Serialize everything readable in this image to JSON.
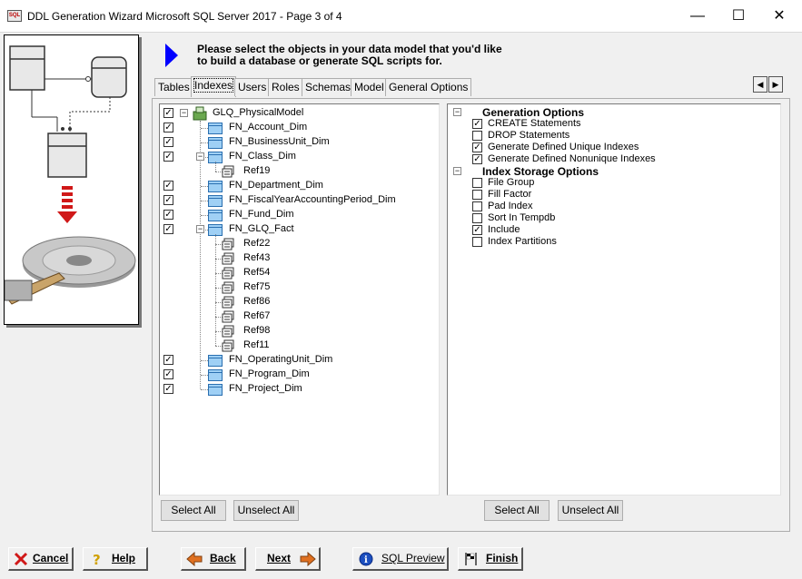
{
  "window": {
    "title": "DDL Generation Wizard Microsoft SQL Server 2017 - Page 3 of 4",
    "app_icon_text": "SQL",
    "minimize": "—",
    "maximize": "☐",
    "close": "✕"
  },
  "banner": {
    "instruction": "Please select the objects in your data model that you'd like to build a database or generate SQL scripts for."
  },
  "tabs": [
    {
      "label": "Tables",
      "active": false
    },
    {
      "label": "Indexes",
      "active": true
    },
    {
      "label": "Users",
      "active": false
    },
    {
      "label": "Roles",
      "active": false
    },
    {
      "label": "Schemas",
      "active": false
    },
    {
      "label": "Model",
      "active": false
    },
    {
      "label": "General Options",
      "active": false
    }
  ],
  "tree": {
    "root": {
      "label": "GLQ_PhysicalModel",
      "checked": true,
      "expanded": true
    },
    "items": [
      {
        "label": "FN_Account_Dim",
        "type": "table",
        "checked": true
      },
      {
        "label": "FN_BusinessUnit_Dim",
        "type": "table",
        "checked": true
      },
      {
        "label": "FN_Class_Dim",
        "type": "table",
        "checked": true,
        "expanded": true
      },
      {
        "label": "Ref19",
        "type": "ref"
      },
      {
        "label": "FN_Department_Dim",
        "type": "table",
        "checked": true
      },
      {
        "label": "FN_FiscalYearAccountingPeriod_Dim",
        "type": "table",
        "checked": true
      },
      {
        "label": "FN_Fund_Dim",
        "type": "table",
        "checked": true
      },
      {
        "label": "FN_GLQ_Fact",
        "type": "table",
        "checked": true,
        "expanded": true
      },
      {
        "label": "Ref22",
        "type": "ref"
      },
      {
        "label": "Ref43",
        "type": "ref"
      },
      {
        "label": "Ref54",
        "type": "ref"
      },
      {
        "label": "Ref75",
        "type": "ref"
      },
      {
        "label": "Ref86",
        "type": "ref"
      },
      {
        "label": "Ref67",
        "type": "ref"
      },
      {
        "label": "Ref98",
        "type": "ref"
      },
      {
        "label": "Ref11",
        "type": "ref"
      },
      {
        "label": "FN_OperatingUnit_Dim",
        "type": "table",
        "checked": true
      },
      {
        "label": "FN_Program_Dim",
        "type": "table",
        "checked": true
      },
      {
        "label": "FN_Project_Dim",
        "type": "table",
        "checked": true
      }
    ]
  },
  "options": {
    "groups": [
      {
        "label": "Generation Options",
        "items": [
          {
            "label": "CREATE Statements",
            "checked": true
          },
          {
            "label": "DROP Statements",
            "checked": false
          },
          {
            "label": "Generate Defined Unique Indexes",
            "checked": true
          },
          {
            "label": "Generate Defined Nonunique Indexes",
            "checked": true
          }
        ]
      },
      {
        "label": "Index Storage Options",
        "items": [
          {
            "label": "File Group",
            "checked": false
          },
          {
            "label": "Fill Factor",
            "checked": false
          },
          {
            "label": "Pad Index",
            "checked": false
          },
          {
            "label": "Sort In Tempdb",
            "checked": false
          },
          {
            "label": "Include",
            "checked": true
          },
          {
            "label": "Index Partitions",
            "checked": false
          }
        ]
      }
    ]
  },
  "tree_buttons": {
    "select_all": "Select All",
    "unselect_all": "Unselect All"
  },
  "options_buttons": {
    "select_all": "Select All",
    "unselect_all": "Unselect All"
  },
  "footer": {
    "cancel": "Cancel",
    "help": "Help",
    "back": "Back",
    "next": "Next",
    "sql_preview": "SQL Preview",
    "finish": "Finish"
  },
  "colors": {
    "accent": "#0000ff",
    "table_icon": "#9fd0f5",
    "cancel_red": "#d01818",
    "arrow_orange": "#e07020"
  }
}
